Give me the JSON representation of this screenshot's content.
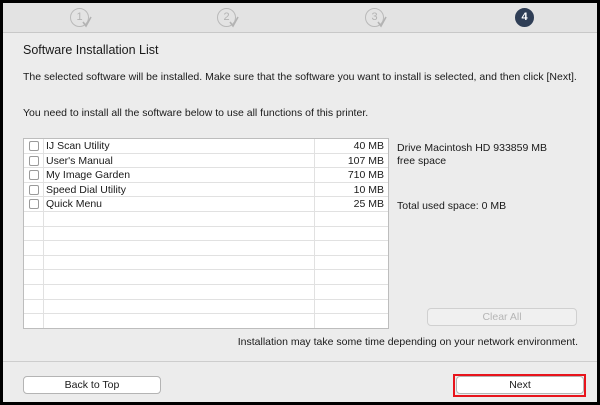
{
  "steps": [
    {
      "number": "1",
      "state": "done"
    },
    {
      "number": "2",
      "state": "done"
    },
    {
      "number": "3",
      "state": "done"
    },
    {
      "number": "4",
      "state": "active"
    }
  ],
  "title": "Software Installation List",
  "instructions": {
    "line1": "The selected software will be installed. Make sure that the software you want to install is selected, and then click [Next].",
    "line2": "You need to install all the software below to use all functions of this printer."
  },
  "software_list": {
    "items": [
      {
        "name": "IJ Scan Utility",
        "size": "40 MB",
        "checked": false
      },
      {
        "name": "User's Manual",
        "size": "107 MB",
        "checked": false
      },
      {
        "name": "My Image Garden",
        "size": "710 MB",
        "checked": false
      },
      {
        "name": "Speed Dial Utility",
        "size": "10 MB",
        "checked": false
      },
      {
        "name": "Quick Menu",
        "size": "25 MB",
        "checked": false
      }
    ]
  },
  "drive_info": {
    "line1": "Drive Macintosh HD 933859 MB",
    "line2": "free space"
  },
  "total_used": "Total used space: 0 MB",
  "clear_all_label": "Clear All",
  "note": "Installation may take some time depending on your network environment.",
  "back_label": "Back to Top",
  "next_label": "Next",
  "colors": {
    "active_step": "#2f3e56",
    "highlight": "#e8141c"
  }
}
